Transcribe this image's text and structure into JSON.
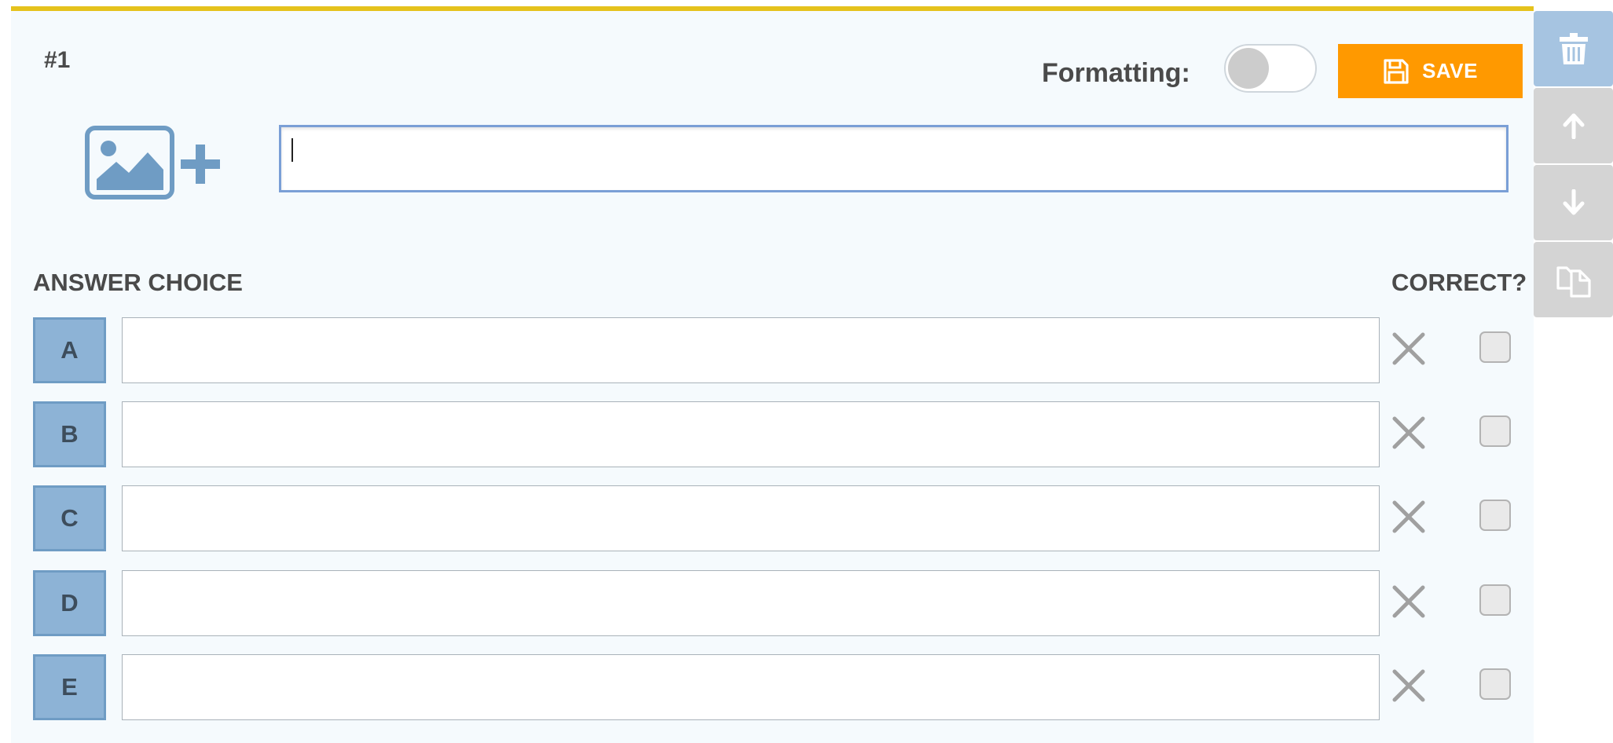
{
  "question": {
    "number": "#1",
    "formatting_label": "Formatting:",
    "formatting_enabled": false,
    "save_label": "SAVE",
    "text_value": ""
  },
  "answers": {
    "column_label": "ANSWER CHOICE",
    "correct_label": "CORRECT?",
    "choices": [
      {
        "letter": "A",
        "value": "",
        "correct": false
      },
      {
        "letter": "B",
        "value": "",
        "correct": false
      },
      {
        "letter": "C",
        "value": "",
        "correct": false
      },
      {
        "letter": "D",
        "value": "",
        "correct": false
      },
      {
        "letter": "E",
        "value": "",
        "correct": false
      }
    ]
  },
  "side_toolbar": {
    "buttons": [
      {
        "icon": "trash-icon",
        "color": "#a6c4e1"
      },
      {
        "icon": "arrow-up-icon",
        "color": "#d4d4d4"
      },
      {
        "icon": "arrow-down-icon",
        "color": "#d4d4d4"
      },
      {
        "icon": "copy-icon",
        "color": "#d4d4d4"
      }
    ]
  },
  "colors": {
    "accent_top_border": "#e5c21c",
    "save_button": "#ff9900",
    "letter_badge": "#8db3d6",
    "image_icon": "#6f9cc4",
    "card_background": "#f5fafd"
  }
}
